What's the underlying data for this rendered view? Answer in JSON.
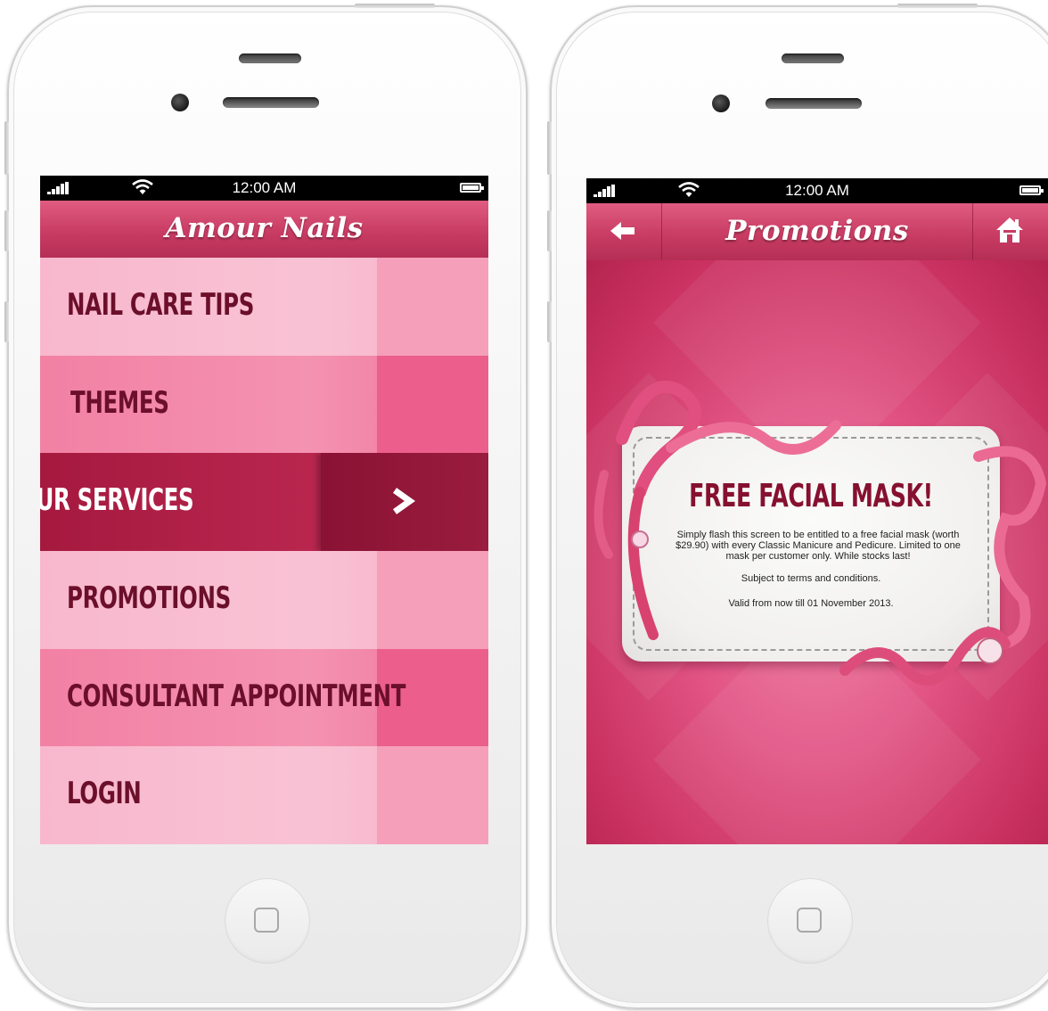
{
  "left_phone": {
    "status": {
      "time": "12:00 AM",
      "icons": [
        "signal-icon",
        "wifi-icon",
        "battery-icon"
      ]
    },
    "header": {
      "title": "Amour Nails"
    },
    "menu": {
      "items": [
        {
          "label": "NAIL CARE TIPS",
          "state": "normal"
        },
        {
          "label": "THEMES",
          "state": "normal"
        },
        {
          "label": "OUR SERVICES",
          "state": "selected",
          "icon": "chevron-right-icon"
        },
        {
          "label": "PROMOTIONS",
          "state": "normal"
        },
        {
          "label": "CONSULTANT APPOINTMENT",
          "state": "normal"
        },
        {
          "label": "LOGIN",
          "state": "normal"
        }
      ]
    }
  },
  "right_phone": {
    "status": {
      "time": "12:00 AM",
      "icons": [
        "signal-icon",
        "wifi-icon",
        "battery-icon"
      ]
    },
    "header": {
      "title": "Promotions",
      "left_icon": "back-arrow-icon",
      "right_icon": "home-icon"
    },
    "promo": {
      "title": "FREE FACIAL MASK!",
      "body": "Simply flash this screen to be entitled to a free facial mask (worth $29.90) with every Classic Manicure and Pedicure. Limited to one mask per customer only. While stocks last!",
      "terms": "Subject to terms and conditions.",
      "validity": "Valid from now till 01 November 2013."
    }
  },
  "colors": {
    "brand_dark": "#86102f",
    "brand": "#c93c64",
    "pink_light": "#f9c2d4",
    "pink_mid": "#f281a4"
  }
}
